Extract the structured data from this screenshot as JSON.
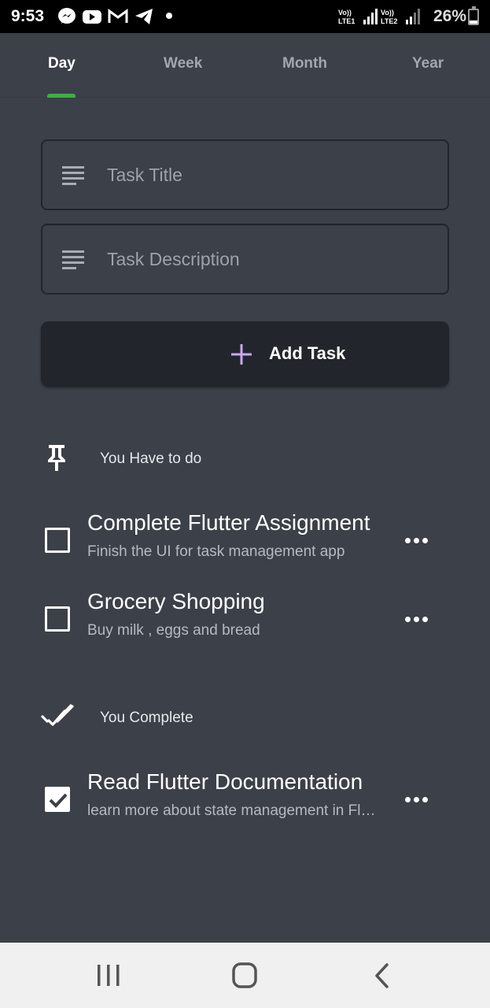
{
  "status_bar": {
    "time": "9:53",
    "notification_icons": [
      "messenger-icon",
      "youtube-icon",
      "gmail-icon",
      "telegram-icon",
      "dot-icon"
    ],
    "sim1_label": "Vo)) LTE1",
    "sim2_label": "Vo)) LTE2",
    "battery_percent_text": "26%",
    "battery_level": 0.26
  },
  "tabs": [
    {
      "label": "Day",
      "active": true
    },
    {
      "label": "Week",
      "active": false
    },
    {
      "label": "Month",
      "active": false
    },
    {
      "label": "Year",
      "active": false
    }
  ],
  "form": {
    "title_placeholder": "Task Title",
    "title_value": "",
    "description_placeholder": "Task Description",
    "description_value": "",
    "add_button_label": "Add Task",
    "icon": "notes-icon"
  },
  "todo_section": {
    "title": "You Have to do",
    "icon": "push-pin-icon",
    "tasks": [
      {
        "title": "Complete Flutter Assignment",
        "description": "Finish the UI for task management app",
        "done": false
      },
      {
        "title": "Grocery Shopping",
        "description": "Buy milk , eggs and bread",
        "done": false
      }
    ]
  },
  "complete_section": {
    "title": "You Complete",
    "icon": "done-all-icon",
    "tasks": [
      {
        "title": "Read Flutter Documentation",
        "description": "learn more about state management in Flutter",
        "done": true
      }
    ]
  },
  "colors": {
    "background": "#3b4049",
    "button_background": "#22262c",
    "tab_indicator": "#3cb043",
    "plus_icon": "#c9a7f2"
  },
  "nav_bar": [
    "recent-apps-icon",
    "home-icon",
    "back-icon"
  ]
}
